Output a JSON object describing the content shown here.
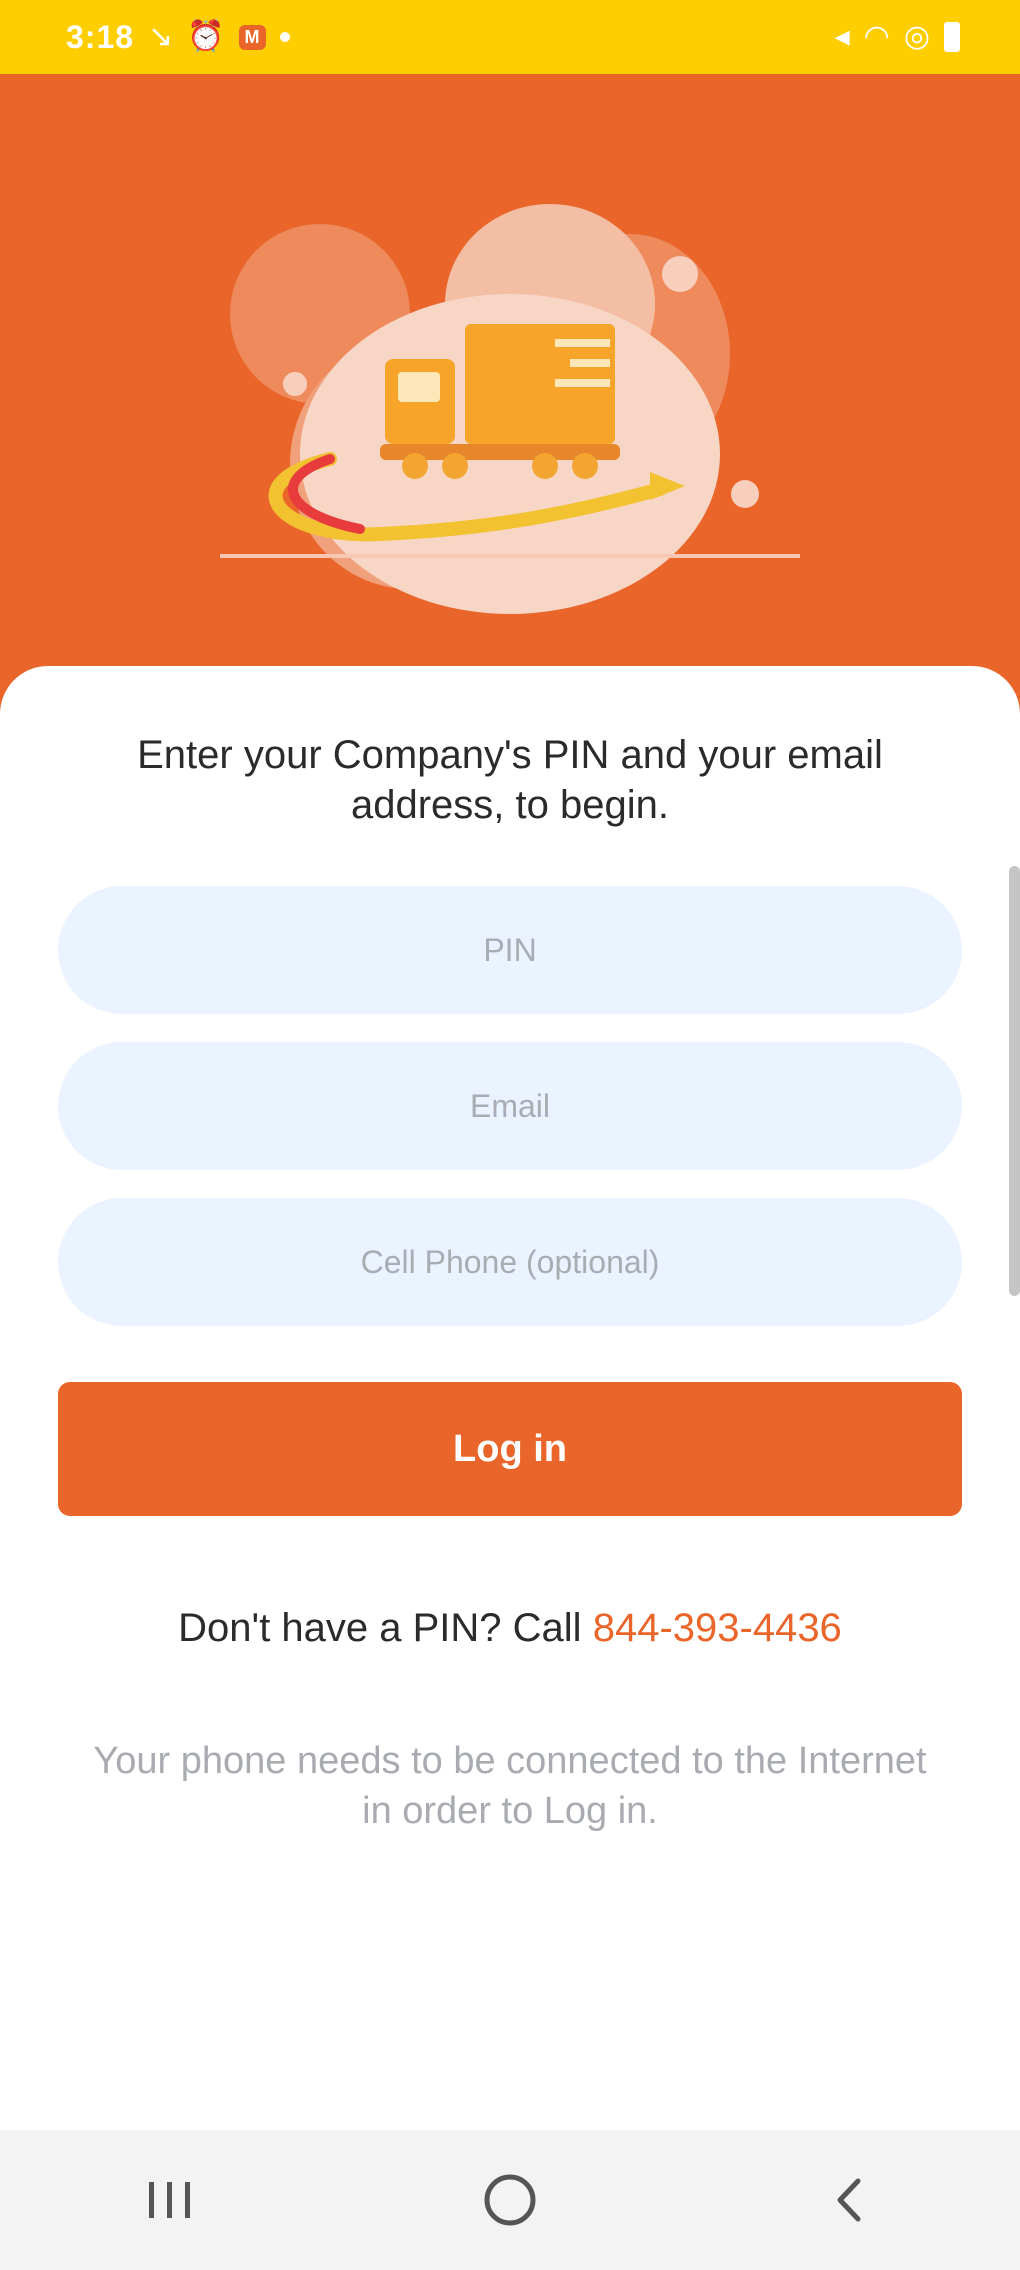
{
  "status_bar": {
    "time": "3:18",
    "notification_badge": "M",
    "icons": [
      "missed-call-icon",
      "alarm-icon",
      "mail-icon",
      "mute-icon",
      "wifi-icon",
      "data-saver-icon",
      "battery-icon"
    ]
  },
  "login": {
    "instruction": "Enter your Company's PIN and your email address, to begin.",
    "pin_placeholder": "PIN",
    "email_placeholder": "Email",
    "phone_placeholder": "Cell Phone (optional)",
    "login_label": "Log in",
    "no_pin_text": "Don't have a PIN? Call",
    "phone_number": "844-393-4436",
    "connection_note": "Your phone needs to be connected to the Internet in order to Log in."
  },
  "nav_bar": {
    "icons": [
      "recent-apps-icon",
      "home-icon",
      "back-icon"
    ]
  },
  "colors": {
    "accent": "#e9652a",
    "status_bar": "#ffce00",
    "input_bg": "#eaf3ff"
  }
}
